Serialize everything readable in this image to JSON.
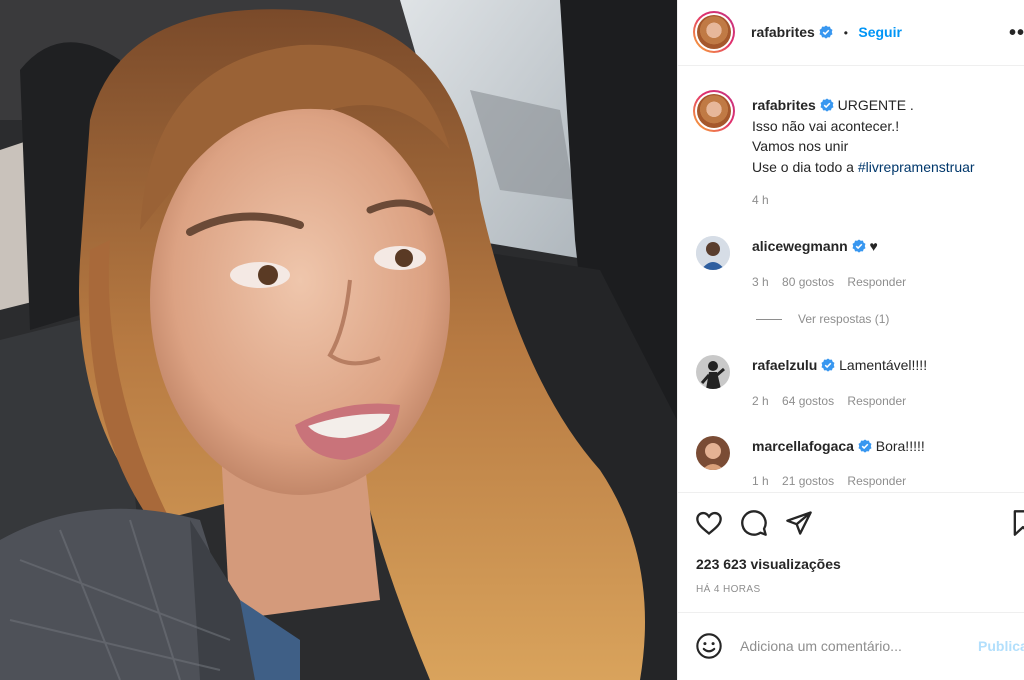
{
  "post": {
    "author": "rafabrites",
    "follow_label": "Seguir",
    "more_label": "•••"
  },
  "caption": {
    "author": "rafabrites",
    "lines": [
      "URGENTE .",
      "Isso não vai acontecer.!",
      "Vamos nos unir",
      "Use o dia todo a "
    ],
    "hashtag": "#livrepramenstruar",
    "time": "4 h"
  },
  "comments": [
    {
      "user": "alicewegmann",
      "text": "♥",
      "time": "3 h",
      "likes": "80 gostos",
      "reply": "Responder",
      "view_replies": "Ver respostas (1)"
    },
    {
      "user": "rafaelzulu",
      "text": "Lamentável!!!!",
      "time": "2 h",
      "likes": "64 gostos",
      "reply": "Responder"
    },
    {
      "user": "marcellafogaca",
      "text": "Bora!!!!!",
      "time": "1 h",
      "likes": "21 gostos",
      "reply": "Responder"
    }
  ],
  "stats": {
    "views": "223 623 visualizações",
    "ago": "HÁ 4 HORAS"
  },
  "add_comment": {
    "placeholder": "Adiciona um comentário...",
    "publish_label": "Publicar"
  },
  "icons": {
    "like": "heart-icon",
    "comment": "comment-bubble-icon",
    "share": "paper-plane-icon",
    "save": "bookmark-icon",
    "emoji": "smiley-icon",
    "verified": "verified-badge-icon"
  },
  "colors": {
    "accent": "#0095f6",
    "hashtag": "#00376b",
    "secondary_text": "#8e8e8e",
    "verified": "#3897f0"
  }
}
